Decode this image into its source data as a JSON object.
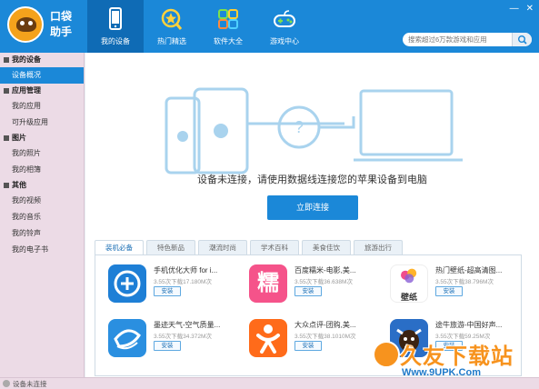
{
  "app": {
    "logo_text": [
      "口袋",
      "助手"
    ]
  },
  "nav": [
    {
      "label": "我的设备",
      "icon": "phone-icon",
      "active": true
    },
    {
      "label": "热门精选",
      "icon": "star-icon",
      "active": false
    },
    {
      "label": "软件大全",
      "icon": "apps-grid-icon",
      "active": false
    },
    {
      "label": "游戏中心",
      "icon": "gamepad-icon",
      "active": false
    }
  ],
  "window": {
    "minimize": "—",
    "close": "✕"
  },
  "search": {
    "placeholder": "搜索超过6万款游戏和应用"
  },
  "sidebar": {
    "groups": [
      {
        "label": "我的设备",
        "items": [
          {
            "label": "设备概况",
            "active": true
          }
        ]
      },
      {
        "label": "应用管理",
        "items": [
          {
            "label": "我的应用"
          },
          {
            "label": "可升级应用"
          }
        ]
      },
      {
        "label": "图片",
        "items": [
          {
            "label": "我的照片"
          },
          {
            "label": "我的相簿"
          }
        ]
      },
      {
        "label": "其他",
        "items": [
          {
            "label": "我的视频"
          },
          {
            "label": "我的音乐"
          },
          {
            "label": "我的铃声"
          },
          {
            "label": "我的电子书"
          }
        ]
      }
    ]
  },
  "main": {
    "connect_message": "设备未连接，请使用数据线连接您的苹果设备到电脑",
    "connect_button": "立即连接",
    "tabs": [
      {
        "label": "装机必备",
        "active": true
      },
      {
        "label": "特色新品"
      },
      {
        "label": "潮流时尚"
      },
      {
        "label": "学术百科"
      },
      {
        "label": "美食佳饮"
      },
      {
        "label": "旅游出行"
      }
    ],
    "apps": [
      {
        "name": "手机优化大师 for i...",
        "meta": "3.55次下载17.180M次",
        "install": "安装",
        "icon": "optimizer-app-icon",
        "color": "#1e7fd6"
      },
      {
        "name": "百度糯米-电影,美...",
        "meta": "3.55次下载36.638M次",
        "install": "安装",
        "icon": "nuomi-app-icon",
        "color": "#f5538a",
        "glyph": "糯"
      },
      {
        "name": "热门壁纸-超高清图...",
        "meta": "3.55次下载38.796M次",
        "install": "安装",
        "icon": "wallpaper-app-icon",
        "color": "#ffffff",
        "glyph": "壁纸"
      },
      {
        "name": "墨迹天气-空气质量...",
        "meta": "3.55次下载34.372M次",
        "install": "安装",
        "icon": "weather-app-icon",
        "color": "#2a8fe0"
      },
      {
        "name": "大众点评-团购,美...",
        "meta": "3.55次下载38.1010M次",
        "install": "安装",
        "icon": "dianping-app-icon",
        "color": "#ff6b1a"
      },
      {
        "name": "途牛旅游-中国好声...",
        "meta": "3.55次下载59.25M次",
        "install": "安装",
        "icon": "tuniu-app-icon",
        "color": "#2a6ec6"
      }
    ]
  },
  "status": {
    "text": "设备未连接"
  },
  "watermark": {
    "text": "久友下载站",
    "url": "Www.9UPK.Com"
  }
}
